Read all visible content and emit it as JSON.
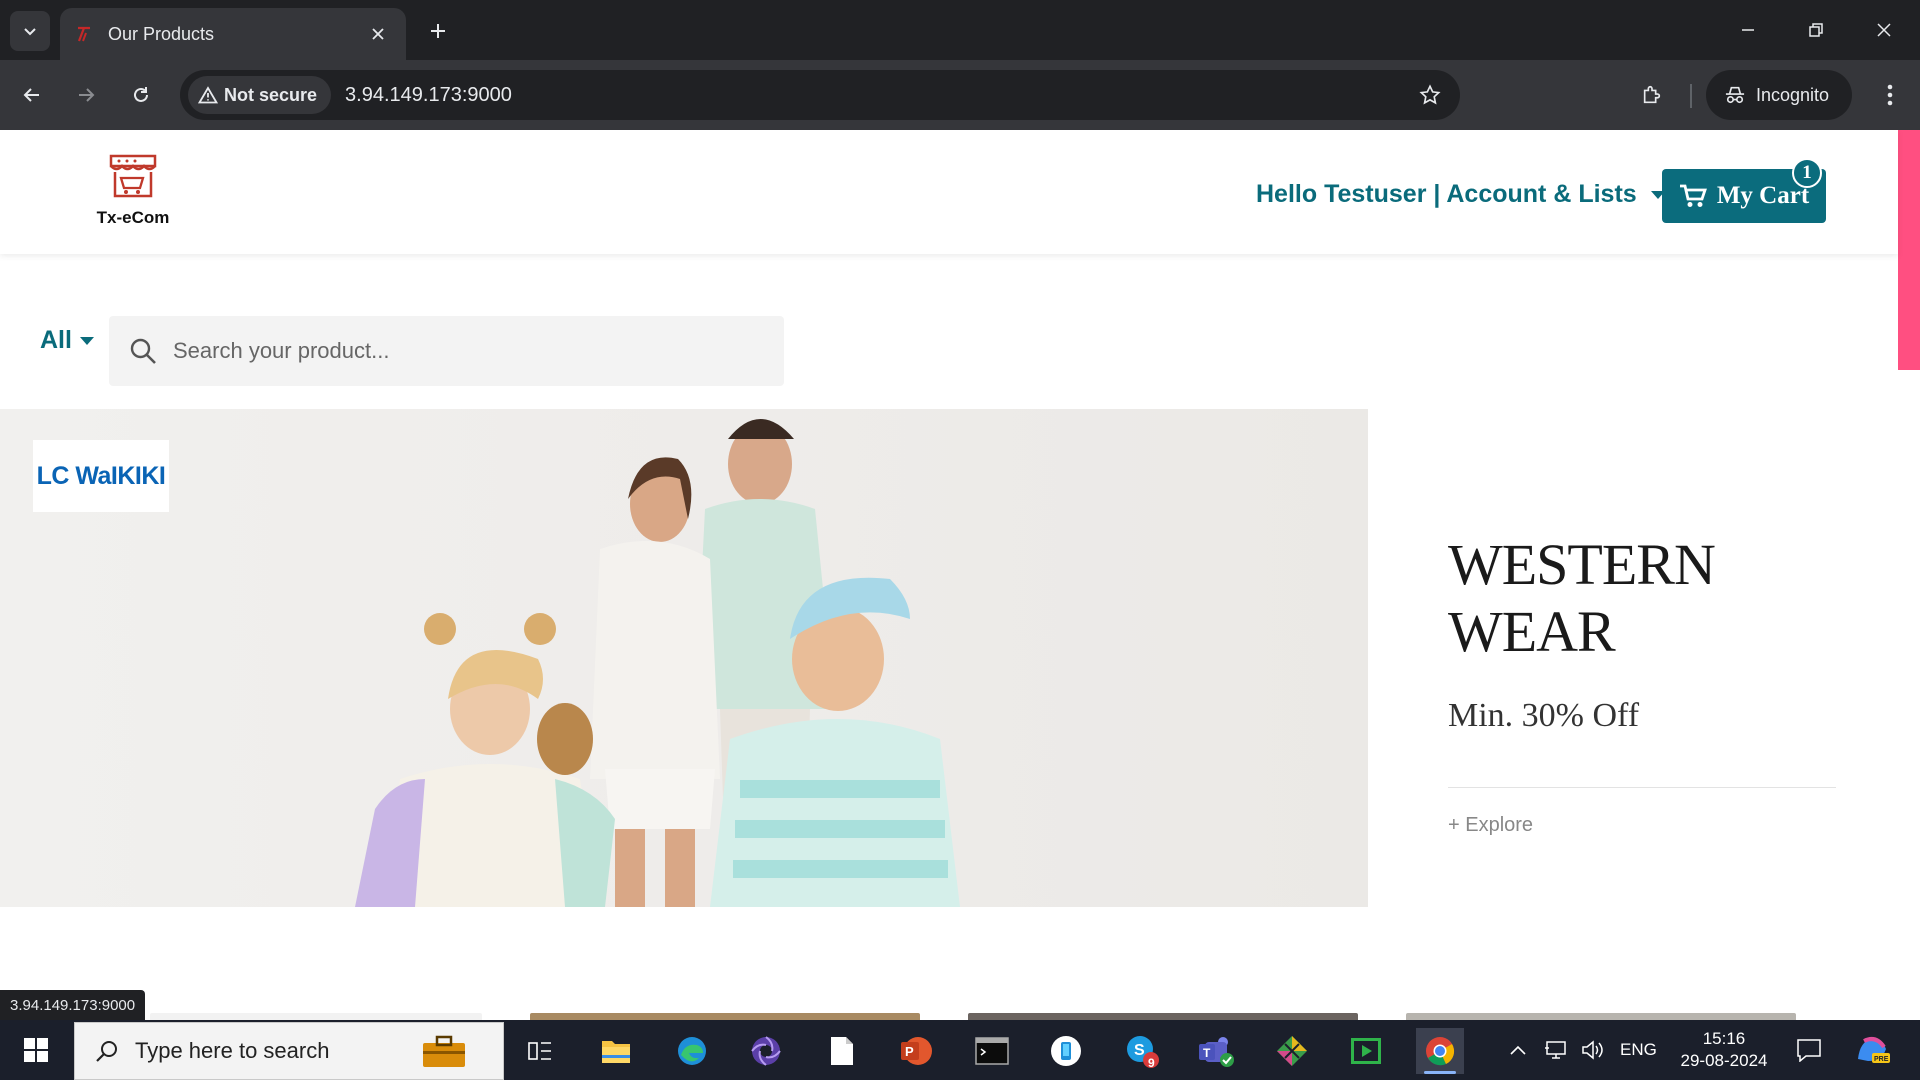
{
  "browser": {
    "tab_title": "Our Products",
    "security_label": "Not secure",
    "url": "3.94.149.173:9000",
    "profile_label": "Incognito",
    "status_url": "3.94.149.173:9000"
  },
  "header": {
    "logo_name": "Tx-eCom",
    "account_label": "Hello Testuser | Account & Lists",
    "cart_label": "My Cart",
    "cart_count": "1"
  },
  "search": {
    "category": "All",
    "placeholder": "Search your product..."
  },
  "banner": {
    "brand": "LC WaIKIKI",
    "title": "WESTERN WEAR",
    "subtitle": "Min. 30% Off",
    "link": "+ Explore"
  },
  "taskbar": {
    "search_placeholder": "Type here to search",
    "language": "ENG",
    "time": "15:16",
    "date": "29-08-2024",
    "skype_badge": "9"
  },
  "colors": {
    "accent": "#0b6c7d",
    "scroll_indicator": "#ff4f81",
    "brand_blue": "#0a64b5"
  }
}
